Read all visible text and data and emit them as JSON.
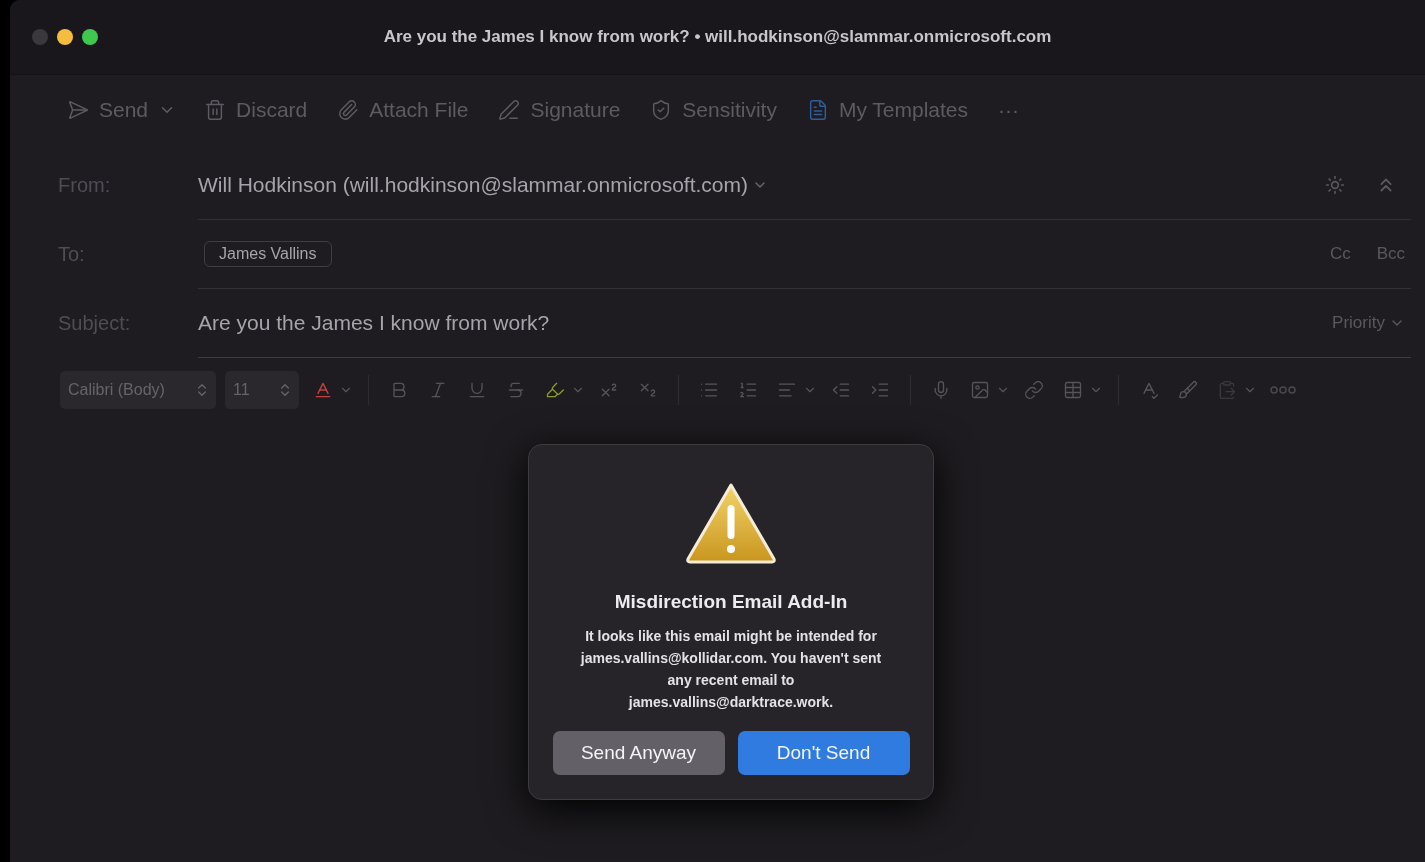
{
  "window": {
    "title": "Are you the James I know from work? • will.hodkinson@slammar.onmicrosoft.com"
  },
  "toolbar": [
    {
      "label": "Send",
      "kind": "send"
    },
    {
      "label": "Discard",
      "kind": "discard"
    },
    {
      "label": "Attach File",
      "kind": "attach"
    },
    {
      "label": "Signature",
      "kind": "signature"
    },
    {
      "label": "Sensitivity",
      "kind": "sensitivity"
    },
    {
      "label": "My Templates",
      "kind": "templates"
    },
    {
      "label": "···",
      "kind": "more"
    }
  ],
  "header": {
    "from": {
      "label": "From:",
      "value": "Will Hodkinson (will.hodkinson@slammar.onmicrosoft.com)"
    },
    "to": {
      "label": "To:",
      "recipients": [
        "James Vallins"
      ],
      "cc": "Cc",
      "bcc": "Bcc"
    },
    "subject": {
      "label": "Subject:",
      "value": "Are you the James I know from work?",
      "priority": "Priority"
    }
  },
  "format_bar": {
    "font": "Calibri (Body)",
    "size": "11"
  },
  "dialog": {
    "title": "Misdirection Email Add-In",
    "message": "It looks like this email might be intended for  james.vallins@kollidar.com. You haven't sent any recent email to james.vallins@darktrace.work.",
    "buttons": [
      {
        "label": "Send Anyway",
        "kind": "secondary"
      },
      {
        "label": "Don't Send",
        "kind": "primary"
      }
    ]
  }
}
